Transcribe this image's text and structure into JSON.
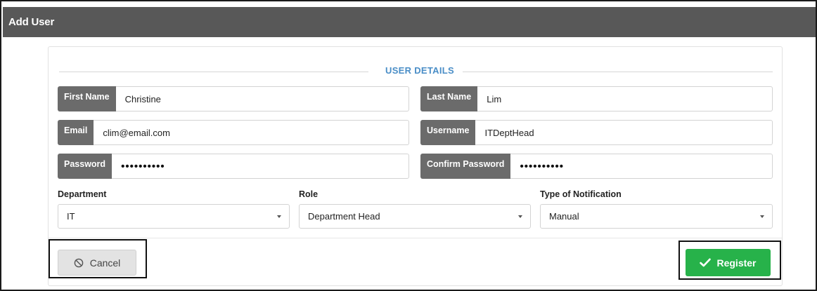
{
  "window": {
    "title": "Add User"
  },
  "section": {
    "title": "USER DETAILS"
  },
  "fields": {
    "first_name": {
      "label": "First Name",
      "value": "Christine"
    },
    "last_name": {
      "label": "Last Name",
      "value": "Lim"
    },
    "email": {
      "label": "Email",
      "value": "clim@email.com"
    },
    "username": {
      "label": "Username",
      "value": "ITDeptHead"
    },
    "password": {
      "label": "Password",
      "value": "••••••••••"
    },
    "confirm_password": {
      "label": "Confirm Password",
      "value": "••••••••••"
    }
  },
  "selects": {
    "department": {
      "label": "Department",
      "value": "IT"
    },
    "role": {
      "label": "Role",
      "value": "Department Head"
    },
    "notification": {
      "label": "Type of Notification",
      "value": "Manual"
    }
  },
  "buttons": {
    "cancel": {
      "label": "Cancel",
      "icon": "ban-icon"
    },
    "register": {
      "label": "Register",
      "icon": "check-icon"
    }
  },
  "colors": {
    "titlebar": "#585858",
    "section_title": "#4a8ec7",
    "addon": "#6b6b6b",
    "register": "#27b24a",
    "cancel": "#e3e3e3"
  }
}
